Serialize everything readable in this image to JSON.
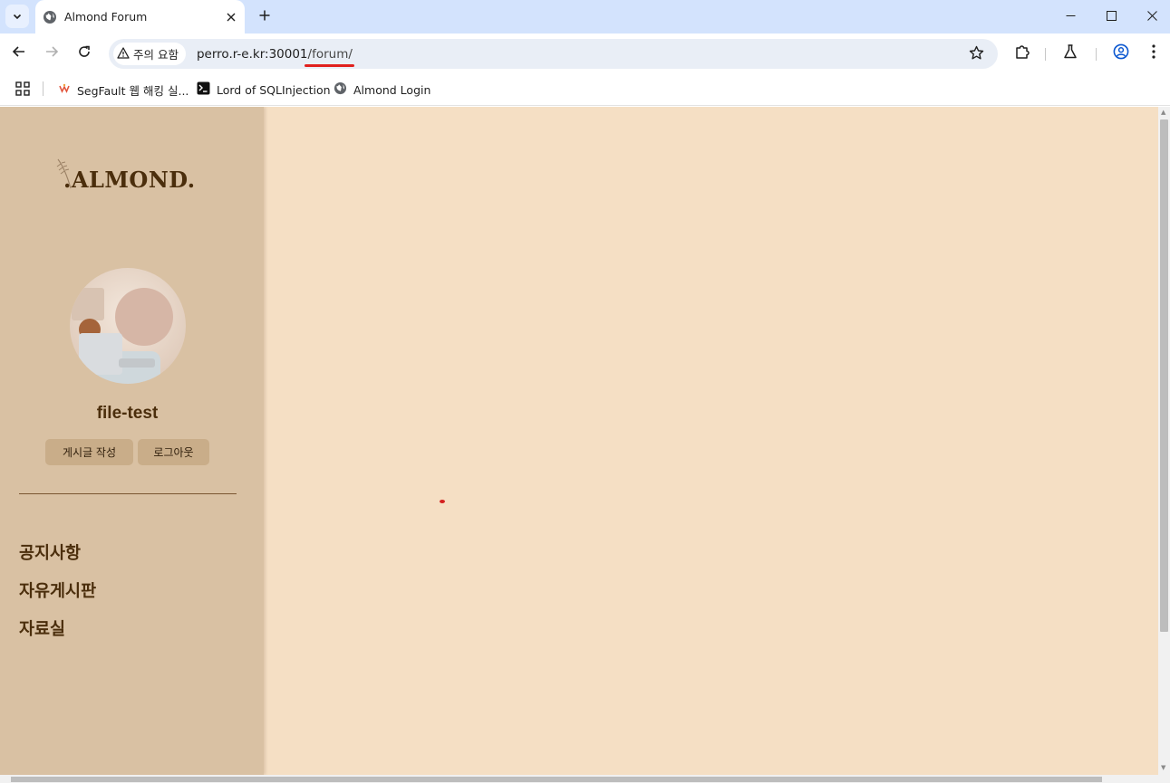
{
  "browser": {
    "tab": {
      "title": "Almond Forum",
      "icon": "globe-icon"
    },
    "security_chip": "주의 요함",
    "url": {
      "host": "perro.r-e.kr:30001",
      "path": "/forum/"
    },
    "bookmarks": [
      {
        "label": "SegFault 웹 해킹 실...",
        "icon": "segfault-icon"
      },
      {
        "label": "Lord of SQLInjection",
        "icon": "terminal-icon"
      },
      {
        "label": "Almond Login",
        "icon": "globe-icon"
      }
    ]
  },
  "sidebar": {
    "logo": ".ALMOND.",
    "username": "file-test",
    "buttons": {
      "write": "게시글 작성",
      "logout": "로그아웃"
    },
    "menu": [
      {
        "label": "공지사항"
      },
      {
        "label": "자유게시판"
      },
      {
        "label": "자료실"
      }
    ]
  },
  "colors": {
    "page_bg": "#f5dfc4",
    "sidebar_bg": "#d9c1a3",
    "text_brown": "#4b2e0c",
    "button_bg": "#c9ad89",
    "tabstrip_bg": "#d3e3fd"
  }
}
